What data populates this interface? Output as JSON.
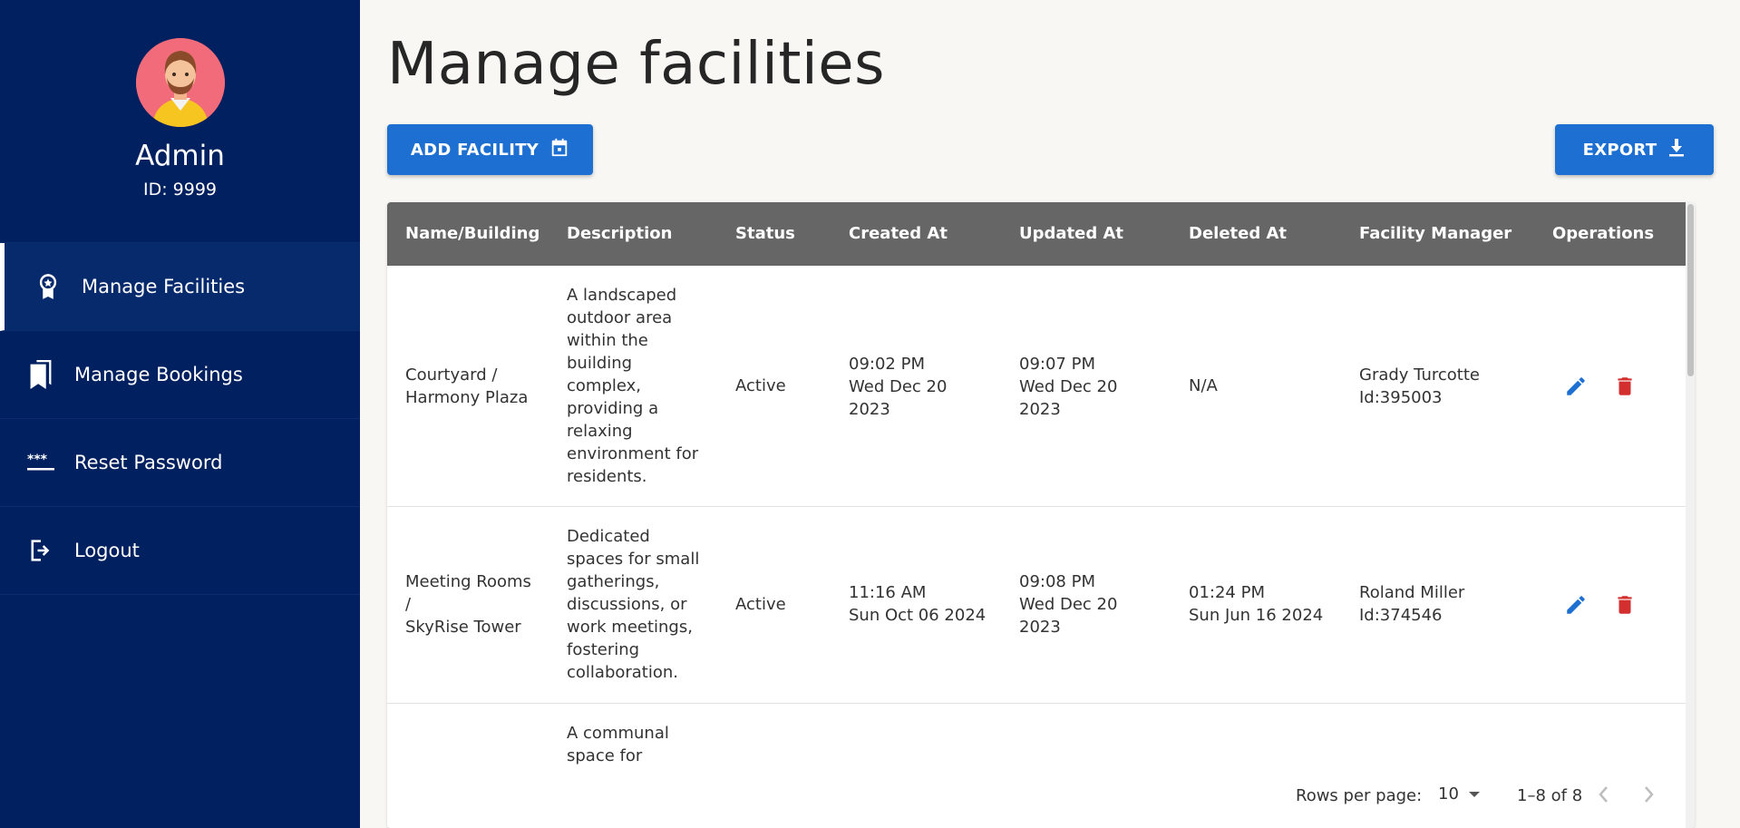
{
  "sidebar": {
    "admin_name": "Admin",
    "admin_id": "ID: 9999",
    "items": [
      {
        "label": "Manage Facilities",
        "icon": "award-icon",
        "active": true
      },
      {
        "label": "Manage Bookings",
        "icon": "bookmarks-icon",
        "active": false
      },
      {
        "label": "Reset Password",
        "icon": "password-icon",
        "active": false
      },
      {
        "label": "Logout",
        "icon": "logout-icon",
        "active": false
      }
    ]
  },
  "main": {
    "title": "Manage facilities",
    "add_button": "ADD FACILITY",
    "export_button": "EXPORT"
  },
  "table": {
    "headers": [
      "Name/Building",
      "Description",
      "Status",
      "Created At",
      "Updated At",
      "Deleted At",
      "Facility Manager",
      "Operations"
    ],
    "rows": [
      {
        "name": [
          "Courtyard /",
          "Harmony Plaza"
        ],
        "description": [
          "A landscaped",
          "outdoor area",
          "within the",
          "building",
          "complex,",
          "providing a",
          "relaxing",
          "environment for",
          "residents."
        ],
        "status": "Active",
        "created": [
          "09:02 PM",
          "Wed Dec 20",
          "2023"
        ],
        "updated": [
          "09:07 PM",
          "Wed Dec 20",
          "2023"
        ],
        "deleted": [
          "N/A"
        ],
        "manager": [
          "Grady Turcotte",
          "Id:395003"
        ]
      },
      {
        "name": [
          "Meeting Rooms",
          "/",
          "SkyRise Tower"
        ],
        "description": [
          "Dedicated",
          "spaces for small",
          "gatherings,",
          "discussions, or",
          "work meetings,",
          "fostering",
          "collaboration."
        ],
        "status": "Active",
        "created": [
          "11:16 AM",
          "Sun Oct 06 2024"
        ],
        "updated": [
          "09:08 PM",
          "Wed Dec 20",
          "2023"
        ],
        "deleted": [
          "01:24 PM",
          "Sun Jun 16 2024"
        ],
        "manager": [
          "Roland Miller",
          "Id:374546"
        ]
      },
      {
        "description": [
          "A communal",
          "space for"
        ]
      }
    ]
  },
  "pagination": {
    "rows_per_page_label": "Rows per page:",
    "rows_per_page_value": "10",
    "range": "1–8 of 8"
  },
  "colors": {
    "sidebar": "#01205f",
    "primary": "#1e6fd2",
    "header": "#666666",
    "edit": "#1e6fd2",
    "delete": "#d32f2f"
  }
}
